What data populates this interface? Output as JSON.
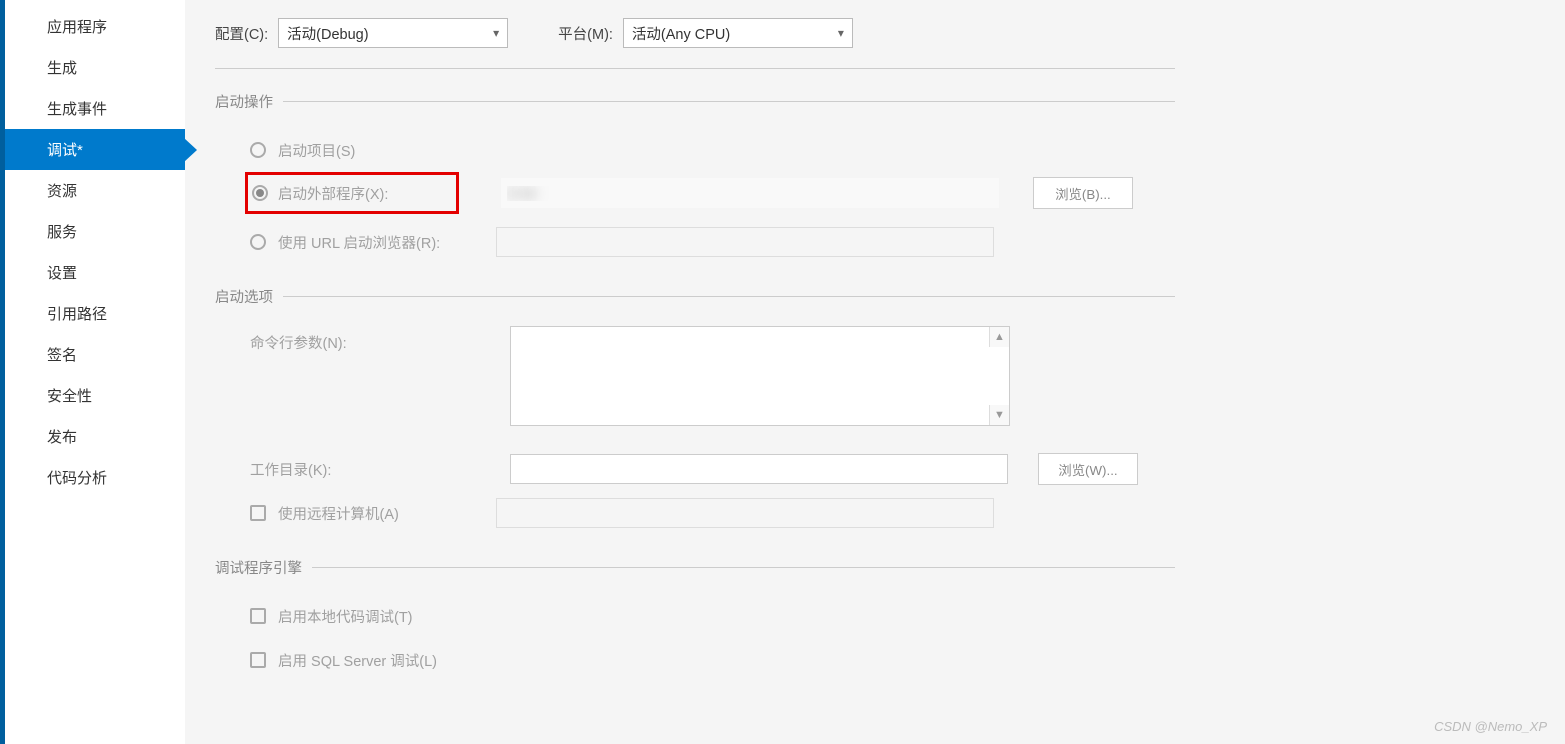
{
  "sidebar": {
    "items": [
      {
        "label": "应用程序"
      },
      {
        "label": "生成"
      },
      {
        "label": "生成事件"
      },
      {
        "label": "调试*"
      },
      {
        "label": "资源"
      },
      {
        "label": "服务"
      },
      {
        "label": "设置"
      },
      {
        "label": "引用路径"
      },
      {
        "label": "签名"
      },
      {
        "label": "安全性"
      },
      {
        "label": "发布"
      },
      {
        "label": "代码分析"
      }
    ],
    "active_index": 3
  },
  "toolbar": {
    "config_label": "配置(C):",
    "config_value": "活动(Debug)",
    "platform_label": "平台(M):",
    "platform_value": "活动(Any CPU)"
  },
  "sections": {
    "start_action": {
      "title": "启动操作",
      "radio_project": "启动项目(S)",
      "radio_external": "启动外部程序(X):",
      "external_path": "D:\\W",
      "browse_b": "浏览(B)...",
      "radio_url": "使用 URL 启动浏览器(R):"
    },
    "start_options": {
      "title": "启动选项",
      "args_label": "命令行参数(N):",
      "workdir_label": "工作目录(K):",
      "browse_w": "浏览(W)...",
      "remote_label": "使用远程计算机(A)"
    },
    "debug_engine": {
      "title": "调试程序引擎",
      "native_label": "启用本地代码调试(T)",
      "sql_label": "启用 SQL Server 调试(L)"
    }
  },
  "watermark": "CSDN @Nemo_XP"
}
